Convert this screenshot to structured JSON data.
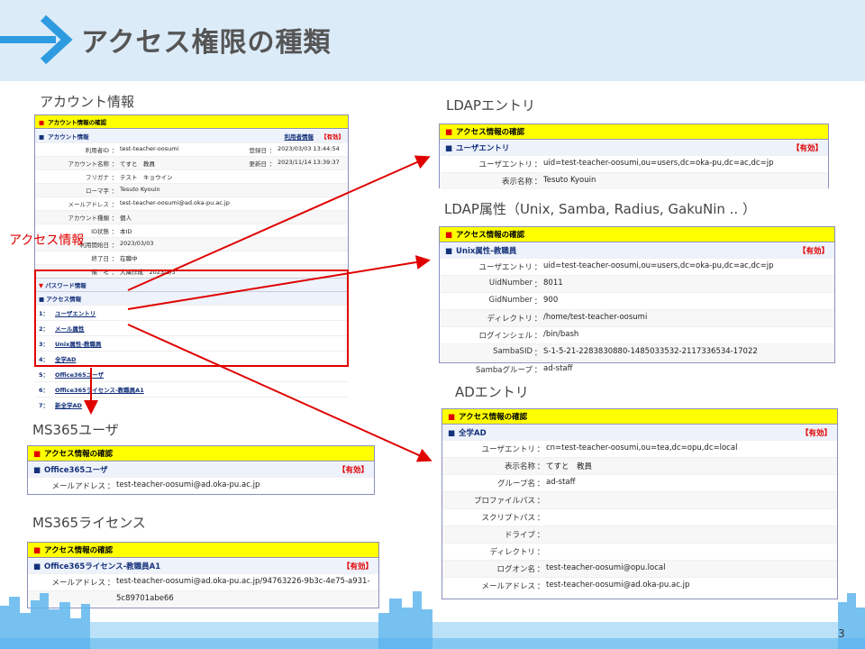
{
  "title": "アクセス権限の種類",
  "page_number": "3",
  "labels": {
    "account": "アカウント情報",
    "access_info": "アクセス情報",
    "ldap_entry": "LDAPエントリ",
    "ldap_attr": "LDAP属性（Unix, Samba, Radius, GakuNin .. ）",
    "ad_entry": "ADエントリ",
    "ms365_user": "MS365ユーザ",
    "ms365_license": "MS365ライセンス"
  },
  "common": {
    "confirm": "アクセス情報の確認",
    "valid": "【有効】",
    "square": "■"
  },
  "account_panel": {
    "header": "アカウント情報の確認",
    "sub": "アカウント情報",
    "link_user": "利用者情報",
    "status": "【有効】",
    "rows": [
      {
        "k": "利用者ID",
        "v": "test-teacher-oosumi",
        "rk": "登録日",
        "rv": "2023/03/03 13:44:54"
      },
      {
        "k": "アカウント名称",
        "v": "てすと　教員",
        "rk": "更新日",
        "rv": "2023/11/14 13:39:37"
      },
      {
        "k": "フリガナ",
        "v": "テスト　キョウイン"
      },
      {
        "k": "ローマ字",
        "v": "Tesuto Kyouin"
      },
      {
        "k": "メールアドレス",
        "v": "test-teacher-oosumi@ad.oka-pu.ac.jp"
      },
      {
        "k": "アカウント種類",
        "v": "個人"
      },
      {
        "k": "ID状態",
        "v": "本ID"
      },
      {
        "k": "利用開始日",
        "v": "2023/03/03"
      },
      {
        "k": "終了日",
        "v": "在職中"
      },
      {
        "k": "備　考",
        "v": "大隅作成　2023/3/3"
      }
    ],
    "password_bar": "パスワード情報",
    "access_header": "アクセス情報",
    "items": [
      {
        "n": "1：",
        "label": "ユーザエントリ"
      },
      {
        "n": "2：",
        "label": "メール属性"
      },
      {
        "n": "3：",
        "label": "Unix属性-教職員"
      },
      {
        "n": "4：",
        "label": "全学AD"
      },
      {
        "n": "5：",
        "label": "Office365ユーザ"
      },
      {
        "n": "6：",
        "label": "Office365ライセンス-教職員A1"
      },
      {
        "n": "7：",
        "label": "新全学AD"
      }
    ]
  },
  "ldap_panel": {
    "sub": "ユーザエントリ",
    "rows": [
      {
        "k": "ユーザエントリ",
        "v": "uid=test-teacher-oosumi,ou=users,dc=oka-pu,dc=ac,dc=jp"
      },
      {
        "k": "表示名称",
        "v": "Tesuto Kyouin"
      }
    ]
  },
  "unix_panel": {
    "sub": "Unix属性-教職員",
    "rows": [
      {
        "k": "ユーザエントリ",
        "v": "uid=test-teacher-oosumi,ou=users,dc=oka-pu,dc=ac,dc=jp"
      },
      {
        "k": "UidNumber",
        "v": "8011"
      },
      {
        "k": "GidNumber",
        "v": "900"
      },
      {
        "k": "ディレクトリ",
        "v": "/home/test-teacher-oosumi"
      },
      {
        "k": "ログインシェル",
        "v": "/bin/bash"
      },
      {
        "k": "SambaSID",
        "v": "S-1-5-21-2283830880-1485033532-2117336534-17022"
      },
      {
        "k": "Sambaグループ",
        "v": "ad-staff"
      }
    ]
  },
  "ad_panel": {
    "sub": "全学AD",
    "rows": [
      {
        "k": "ユーザエントリ",
        "v": "cn=test-teacher-oosumi,ou=tea,dc=opu,dc=local"
      },
      {
        "k": "表示名称",
        "v": "てすと　教員"
      },
      {
        "k": "グループ名",
        "v": "ad-staff"
      },
      {
        "k": "プロファイルパス",
        "v": ""
      },
      {
        "k": "スクリプトパス",
        "v": ""
      },
      {
        "k": "ドライブ",
        "v": ""
      },
      {
        "k": "ディレクトリ",
        "v": ""
      },
      {
        "k": "ログオン名",
        "v": "test-teacher-oosumi@opu.local"
      },
      {
        "k": "メールアドレス",
        "v": "test-teacher-oosumi@ad.oka-pu.ac.jp"
      }
    ]
  },
  "o365user_panel": {
    "sub": "Office365ユーザ",
    "rows": [
      {
        "k": "メールアドレス",
        "v": "test-teacher-oosumi@ad.oka-pu.ac.jp"
      }
    ]
  },
  "o365lic_panel": {
    "sub": "Office365ライセンス-教職員A1",
    "rows": [
      {
        "k": "メールアドレス",
        "v": "test-teacher-oosumi@ad.oka-pu.ac.jp/94763226-9b3c-4e75-a931-"
      },
      {
        "k": "",
        "v": "5c89701abe66"
      }
    ]
  },
  "colors": {
    "accent": "#2e9be0",
    "header_bg": "#dcebf8",
    "city": "#5fb6ee",
    "arrow": "#e00000"
  }
}
